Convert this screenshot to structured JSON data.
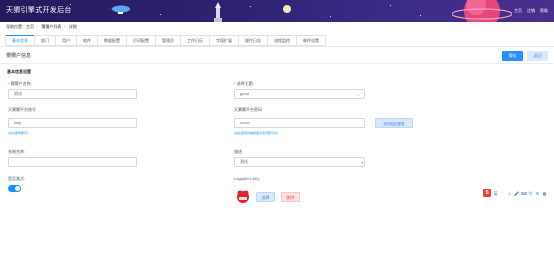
{
  "header": {
    "title": "天猬引擎式开发后台",
    "nav": [
      "主页",
      "注销",
      "帮助"
    ]
  },
  "breadcrumb": [
    "导航位置：主页",
    "猬猬户列表",
    "详细"
  ],
  "tabs": [
    {
      "label": "基本信息",
      "active": true
    },
    {
      "label": "部门",
      "active": false
    },
    {
      "label": "用户",
      "active": false
    },
    {
      "label": "软件",
      "active": false
    },
    {
      "label": "数据配置",
      "active": false
    },
    {
      "label": "打印配置",
      "active": false
    },
    {
      "label": "管理员",
      "active": false
    },
    {
      "label": "工作日历",
      "active": false
    },
    {
      "label": "字段扩展",
      "active": false
    },
    {
      "label": "操作日志",
      "active": false
    },
    {
      "label": "流程监控",
      "active": false
    },
    {
      "label": "邮件设置",
      "active": false
    }
  ],
  "page": {
    "title": "猬猬户信息",
    "save": "保存",
    "back": "返回",
    "section": "基本信息设置"
  },
  "form": {
    "tenant_name_label": "猬猬户名称:",
    "tenant_name_value": "测试",
    "theme_label": "选择主题:",
    "theme_value": "good",
    "account_label": "天猬猬平台账号",
    "account_value": "csty",
    "account_hint": "(关注账号即可)",
    "password_label": "天猬猬平台密码",
    "password_value": "•••••••",
    "password_hint": "(请在密码列编辑里实现天猬平台)",
    "verify_button": "测试验证登录",
    "system_name_label": "系统名称:",
    "system_name_value": "",
    "description_label": "描述:",
    "description_value": "测试",
    "enabled_label": "是否激活:",
    "enabled": true,
    "logo_label": "Logo(60 x 60):",
    "upload_button": "选择",
    "delete_button": "删除"
  },
  "ime": {
    "logo": "S",
    "icons": [
      "英",
      "ʼ",
      "☺",
      "🎤",
      "⌨",
      "👕",
      "⚙",
      "▦"
    ]
  },
  "colors": {
    "accent": "#1890ff",
    "header": "#2f2374",
    "danger": "#e65454"
  }
}
